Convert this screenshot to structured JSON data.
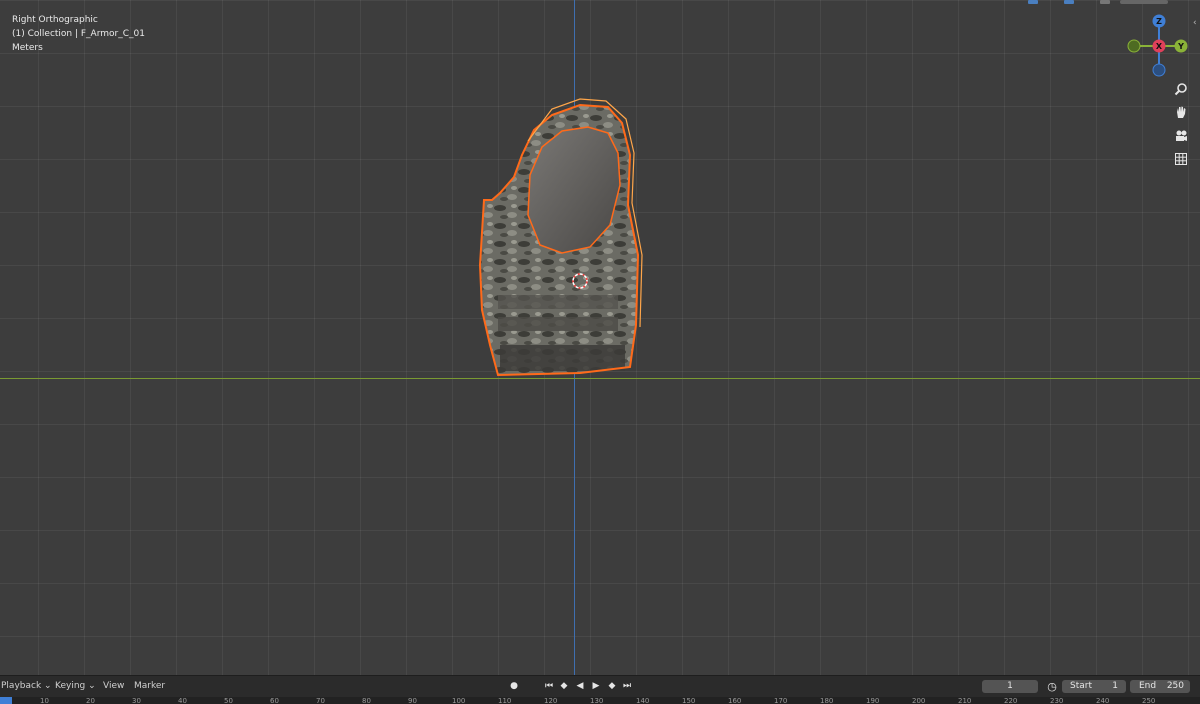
{
  "viewport": {
    "view_name": "Right Orthographic",
    "collection": "(1) Collection | F_Armor_C_01",
    "units": "Meters"
  },
  "gizmo": {
    "z": "Z",
    "x": "X",
    "y": "Y"
  },
  "nav_icons": [
    "zoom-icon",
    "pan-hand-icon",
    "camera-icon",
    "grid-icon"
  ],
  "timeline": {
    "menus": {
      "playback": "Playback",
      "keying": "Keying",
      "view": "View",
      "marker": "Marker"
    },
    "current_frame": "1",
    "start_label": "Start",
    "start_value": "1",
    "end_label": "End",
    "end_value": "250",
    "ruler_ticks": [
      "10",
      "20",
      "30",
      "40",
      "50",
      "60",
      "70",
      "80",
      "90",
      "100",
      "110",
      "120",
      "130",
      "140",
      "150",
      "160",
      "170",
      "180",
      "190",
      "200",
      "210",
      "220",
      "230",
      "240",
      "250"
    ]
  },
  "colors": {
    "selection_outline": "#ff6a1a",
    "axis_z": "#3f6fb0",
    "axis_y": "#7a9a32",
    "gizmo_x": "#e0405a",
    "gizmo_y": "#8ab238",
    "gizmo_z": "#3f7fd6"
  }
}
